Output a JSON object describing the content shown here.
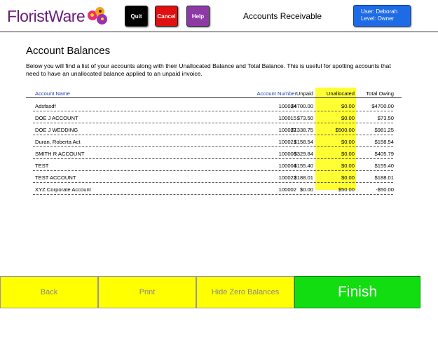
{
  "header": {
    "logo_text": "FloristWare",
    "quit_label": "Quit",
    "cancel_label": "Cancel",
    "help_label": "Help",
    "screen_title": "Accounts Receivable",
    "user_line": "User: Deborah",
    "level_line": "Level: Owner"
  },
  "main": {
    "title": "Account Balances",
    "description": "Below you will find a list of your accounts along with their Unallocated Balance and Total Balance. This is useful for spotting accounts that need to have an unallocated balance applied to an unpaid invoice."
  },
  "table": {
    "columns": {
      "name": "Account Name",
      "number": "Account Number",
      "unpaid": "Unpaid",
      "unallocated": "Unallocated",
      "total": "Total Owing"
    },
    "rows": [
      {
        "name": "Adsfasdf",
        "number": "100024",
        "unpaid": "$4700.00",
        "unallocated": "$0.00",
        "total": "$4700.00"
      },
      {
        "name": "DOE J ACCOUNT",
        "number": "100015",
        "unpaid": "$73.50",
        "unallocated": "$0.00",
        "total": "$73.50"
      },
      {
        "name": "DOE J WEDDING",
        "number": "100027",
        "unpaid": "$1338.75",
        "unallocated": "$500.00",
        "total": "$981.25"
      },
      {
        "name": "Duran, Roberta Act",
        "number": "100021",
        "unpaid": "$158.54",
        "unallocated": "$0.00",
        "total": "$158.54"
      },
      {
        "name": "SMITH R ACCOUNT",
        "number": "100008",
        "unpaid": "$329.84",
        "unallocated": "$0.00",
        "total": "$405.79"
      },
      {
        "name": "TEST",
        "number": "100004",
        "unpaid": "$155.40",
        "unallocated": "$0.00",
        "total": "$155.40"
      },
      {
        "name": "TEST ACCOUNT",
        "number": "100022",
        "unpaid": "$188.01",
        "unallocated": "$0.00",
        "total": "$188.01"
      },
      {
        "name": "XYZ Corporate Account",
        "number": "100002",
        "unpaid": "$0.00",
        "unallocated": "$50.00",
        "total": "-$50.00"
      }
    ]
  },
  "footer": {
    "back_label": "Back",
    "print_label": "Print",
    "hide_zero_label": "Hide Zero Balances",
    "finish_label": "Finish"
  },
  "colors": {
    "highlight": "#ffff33",
    "action_yellow": "#ffff00",
    "finish_green": "#11dd11",
    "user_blue": "#1e6be6"
  }
}
